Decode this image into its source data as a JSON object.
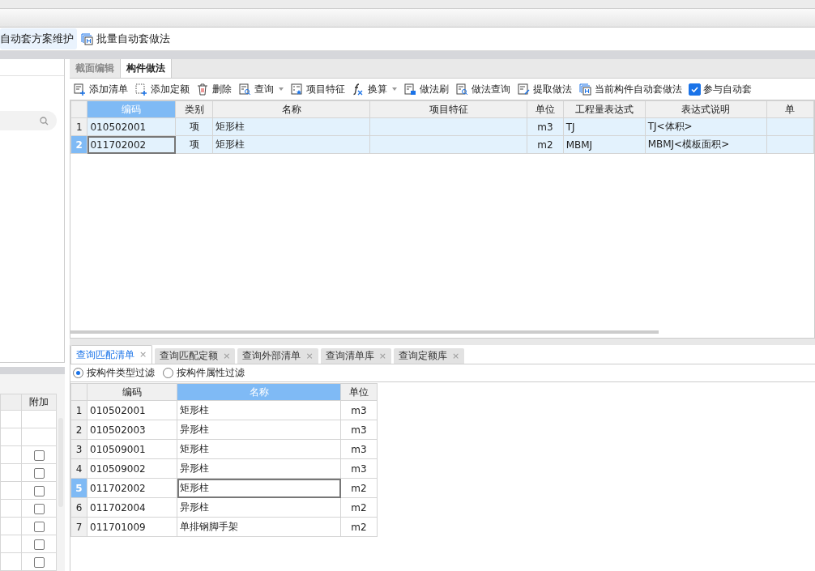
{
  "top_toolbar": {
    "buttons": [
      {
        "label": "自动套方案维护",
        "selected": true
      },
      {
        "label": "批量自动套做法",
        "selected": false
      }
    ]
  },
  "left_panel": {
    "grid": {
      "columns": [
        "附加"
      ],
      "rows": [
        {
          "kind": "empty"
        },
        {
          "kind": "empty"
        },
        {
          "kind": "checkbox",
          "checked": false
        },
        {
          "kind": "checkbox",
          "checked": false
        },
        {
          "kind": "checkbox",
          "checked": false
        },
        {
          "kind": "checkbox",
          "checked": false
        },
        {
          "kind": "checkbox",
          "checked": false
        },
        {
          "kind": "checkbox",
          "checked": false
        },
        {
          "kind": "checkbox",
          "checked": false
        }
      ]
    }
  },
  "tabs": [
    {
      "label": "截面编辑",
      "selected": false
    },
    {
      "label": "构件做法",
      "selected": true
    }
  ],
  "toolbar": {
    "items": [
      {
        "label": "添加清单",
        "dropdown": false
      },
      {
        "label": "添加定额",
        "dropdown": false
      },
      {
        "label": "删除",
        "dropdown": false
      },
      {
        "label": "查询",
        "dropdown": true
      },
      {
        "label": "项目特征",
        "dropdown": false
      },
      {
        "label": "换算",
        "dropdown": true
      },
      {
        "label": "做法刷",
        "dropdown": false
      },
      {
        "label": "做法查询",
        "dropdown": false
      },
      {
        "label": "提取做法",
        "dropdown": false
      },
      {
        "label": "当前构件自动套做法",
        "dropdown": false
      }
    ],
    "auto_checkbox": {
      "label": "参与自动套",
      "checked": true
    }
  },
  "method_table": {
    "columns": [
      {
        "label": "编码",
        "selected": true
      },
      {
        "label": "类别",
        "selected": false
      },
      {
        "label": "名称",
        "selected": false
      },
      {
        "label": "项目特征",
        "selected": false
      },
      {
        "label": "单位",
        "selected": false
      },
      {
        "label": "工程量表达式",
        "selected": false
      },
      {
        "label": "表达式说明",
        "selected": false
      },
      {
        "label": "单",
        "selected": false
      }
    ],
    "rows": [
      {
        "number": "1",
        "selected": false,
        "code": "010502001",
        "category": "项",
        "name": "矩形柱",
        "unit": "m3",
        "quantity_expression": "TJ",
        "expression_note": "TJ<体积>"
      },
      {
        "number": "2",
        "selected": true,
        "code": "011702002",
        "category": "项",
        "name": "矩形柱",
        "unit": "m2",
        "quantity_expression": "MBMJ",
        "expression_note": "MBMJ<模板面积>"
      }
    ]
  },
  "query_tabs": [
    {
      "label": "查询匹配清单",
      "close": "×",
      "selected": true
    },
    {
      "label": "查询匹配定额",
      "close": "×",
      "selected": false
    },
    {
      "label": "查询外部清单",
      "close": "×",
      "selected": false
    },
    {
      "label": "查询清单库",
      "close": "×",
      "selected": false
    },
    {
      "label": "查询定额库",
      "close": "×",
      "selected": false
    }
  ],
  "filters": [
    {
      "label": "按构件类型过滤",
      "selected": true
    },
    {
      "label": "按构件属性过滤",
      "selected": false
    }
  ],
  "match_table": {
    "columns": [
      {
        "label": "编码",
        "selected": false
      },
      {
        "label": "名称",
        "selected": true
      },
      {
        "label": "单位",
        "selected": false
      }
    ],
    "rows": [
      {
        "number": "1",
        "selected": false,
        "code": "010502001",
        "name": "矩形柱",
        "unit": "m3"
      },
      {
        "number": "2",
        "selected": false,
        "code": "010502003",
        "name": "异形柱",
        "unit": "m3"
      },
      {
        "number": "3",
        "selected": false,
        "code": "010509001",
        "name": "矩形柱",
        "unit": "m3"
      },
      {
        "number": "4",
        "selected": false,
        "code": "010509002",
        "name": "异形柱",
        "unit": "m3"
      },
      {
        "number": "5",
        "selected": true,
        "code": "011702002",
        "name": "矩形柱",
        "unit": "m2"
      },
      {
        "number": "6",
        "selected": false,
        "code": "011702004",
        "name": "异形柱",
        "unit": "m2"
      },
      {
        "number": "7",
        "selected": false,
        "code": "011701009",
        "name": "单排钢脚手架",
        "unit": "m2"
      }
    ]
  }
}
